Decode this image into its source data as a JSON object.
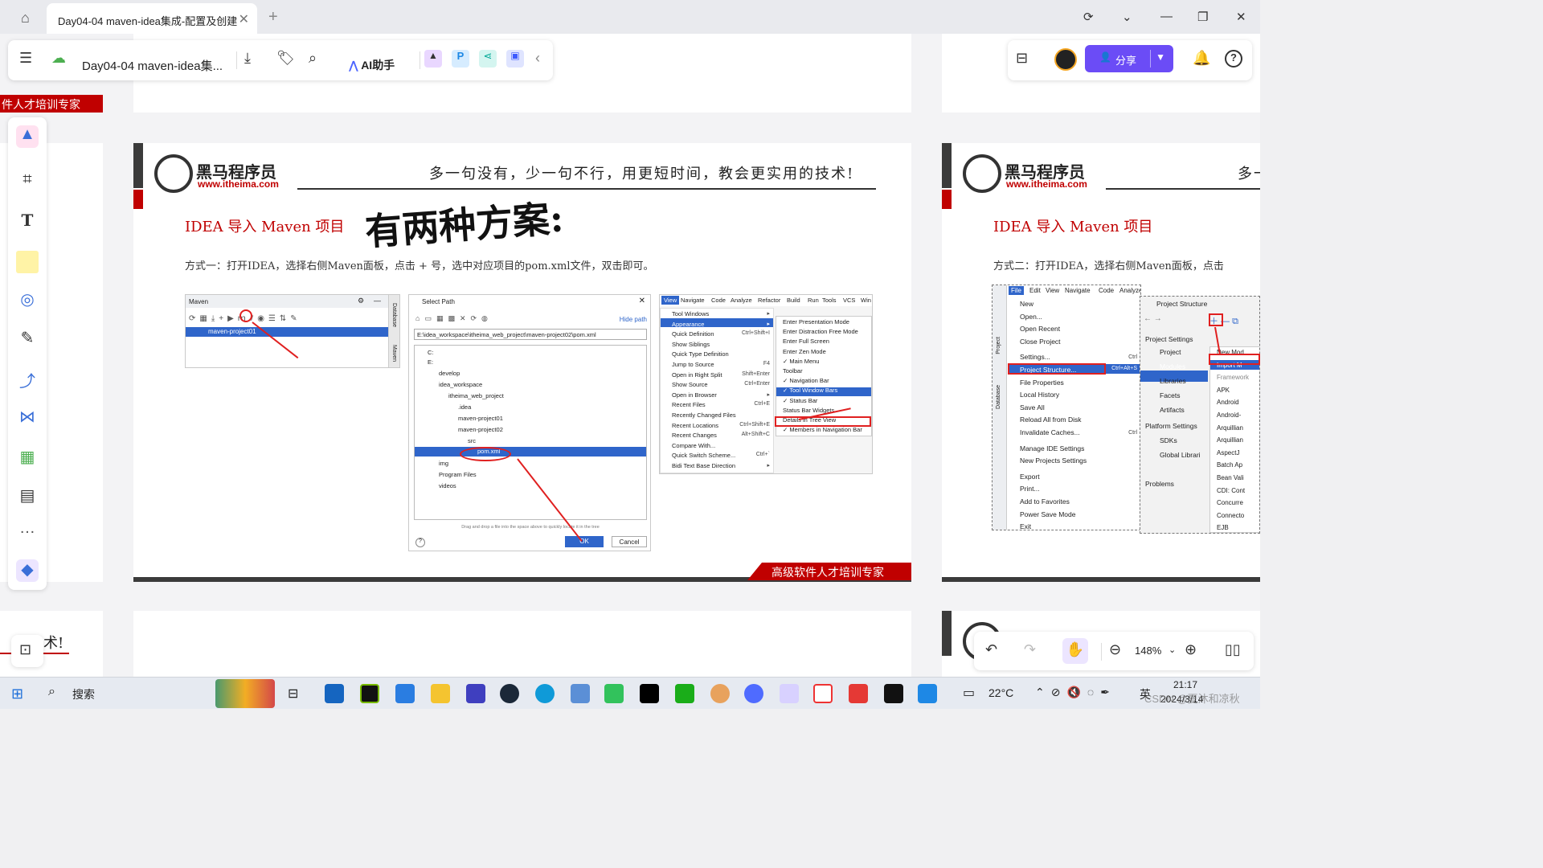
{
  "browser": {
    "tab_title": "Day04-04 maven-idea集成-配置及创建",
    "tab_close": "✕",
    "new_tab": "+"
  },
  "app_toolbar": {
    "doc_name": "Day04-04 maven-idea集...",
    "ai_label": "AI助手",
    "share_label": "分享"
  },
  "slide_left_partial": {
    "top_label": "件人才培训专家",
    "bottom_text": "术!"
  },
  "slide_main": {
    "brand": "黑马程序员",
    "brand_url": "www.itheima.com",
    "slogan": "多一句没有，少一句不行，用更短时间，教会更实用的技术!",
    "title": "IDEA 导入 Maven 项目",
    "handwriting": "有两种方案:",
    "method": "方式一：打开IDEA，选择右侧Maven面板，点击 + 号，选中对应项目的pom.xml文件，双击即可。",
    "footer": "高级软件人才培训专家"
  },
  "maven_panel": {
    "title": "Maven",
    "project": "maven-project01",
    "side_tabs": [
      "Database",
      "Maven"
    ]
  },
  "select_path": {
    "title": "Select Path",
    "hide_path": "Hide path",
    "path": "E:\\idea_workspace\\itheima_web_project\\maven-project02\\pom.xml",
    "tree": [
      "C:",
      "E:",
      "develop",
      "idea_workspace",
      "itheima_web_project",
      ".idea",
      "maven-project01",
      "maven-project02",
      "src",
      "pom.xml",
      "img",
      "Program Files",
      "videos"
    ],
    "hint": "Drag and drop a file into the space above to quickly locate it in the tree",
    "ok": "OK",
    "cancel": "Cancel",
    "help": "?"
  },
  "view_menu": {
    "menubar": [
      "View",
      "Navigate",
      "Code",
      "Analyze",
      "Refactor",
      "Build",
      "Run",
      "Tools",
      "VCS",
      "Win"
    ],
    "items": [
      {
        "label": "Tool Windows",
        "key": "▸"
      },
      {
        "label": "Appearance",
        "key": "▸"
      },
      {
        "label": "Quick Definition",
        "key": "Ctrl+Shift+I"
      },
      {
        "label": "Show Siblings",
        "key": ""
      },
      {
        "label": "Quick Type Definition",
        "key": ""
      },
      {
        "label": "Jump to Source",
        "key": "F4"
      },
      {
        "label": "Open in Right Split",
        "key": "Shift+Enter"
      },
      {
        "label": "Show Source",
        "key": "Ctrl+Enter"
      },
      {
        "label": "Open in Browser",
        "key": "▸"
      },
      {
        "label": "Recent Files",
        "key": "Ctrl+E"
      },
      {
        "label": "Recently Changed Files",
        "key": ""
      },
      {
        "label": "Recent Locations",
        "key": "Ctrl+Shift+E"
      },
      {
        "label": "Recent Changes",
        "key": "Alt+Shift+C"
      },
      {
        "label": "Compare With...",
        "key": ""
      },
      {
        "label": "Quick Switch Scheme...",
        "key": "Ctrl+`"
      },
      {
        "label": "Bidi Text Base Direction",
        "key": "▸"
      }
    ],
    "submenu": [
      "Enter Presentation Mode",
      "Enter Distraction Free Mode",
      "Enter Full Screen",
      "Enter Zen Mode",
      "✓ Main Menu",
      "Toolbar",
      "✓ Navigation Bar",
      "✓ Tool Window Bars",
      "✓ Status Bar",
      "Status Bar Widgets",
      "Details in Tree View",
      "✓ Members in Navigation Bar"
    ]
  },
  "slide_right": {
    "brand": "黑马程序员",
    "brand_url": "www.itheima.com",
    "slogan_partial": "多一",
    "title": "IDEA 导入 Maven 项目",
    "method": "方式二：打开IDEA，选择右侧Maven面板，点击"
  },
  "file_menu": {
    "menubar": [
      "File",
      "Edit",
      "View",
      "Navigate",
      "Code",
      "Analyze"
    ],
    "items": [
      "New",
      "Open...",
      "Open Recent",
      "Close Project",
      "Settings...",
      "Project Structure...",
      "File Properties",
      "Local History",
      "Save All",
      "Reload All from Disk",
      "Invalidate Caches...",
      "Manage IDE Settings",
      "New Projects Settings",
      "Export",
      "Print...",
      "Add to Favorites",
      "Power Save Mode",
      "Exit"
    ],
    "project_structure_key": "Ctrl+Alt+S",
    "settings_key": "Ctrl",
    "reload_key": "Ctrl",
    "side_tabs": [
      "Project",
      "Database"
    ]
  },
  "project_structure": {
    "title": "Project Structure",
    "nav": [
      "Project Settings",
      "Project",
      "Modules",
      "Libraries",
      "Facets",
      "Artifacts",
      "Platform Settings",
      "SDKs",
      "Global Librari",
      "Problems"
    ],
    "popup": [
      "New Mod",
      "Import M",
      "Framework",
      "APK",
      "Android",
      "Android-",
      "Arquillian",
      "Arquillian",
      "AspectJ",
      "Batch Ap",
      "Bean Vali",
      "CDI: Cont",
      "Concurre",
      "Connecto",
      "EJB"
    ]
  },
  "zoom": {
    "level": "148%"
  },
  "taskbar": {
    "search": "搜索",
    "weather": "22°C",
    "ime": "英",
    "time": "21:17",
    "date": "2024/3/14",
    "watermark": "CSDN @夏沐和凉秋"
  },
  "colors": {
    "brand_red": "#c00000",
    "share_purple": "#6b4cf6",
    "ide_select": "#2f65ca",
    "annotation_red": "#e02020"
  }
}
